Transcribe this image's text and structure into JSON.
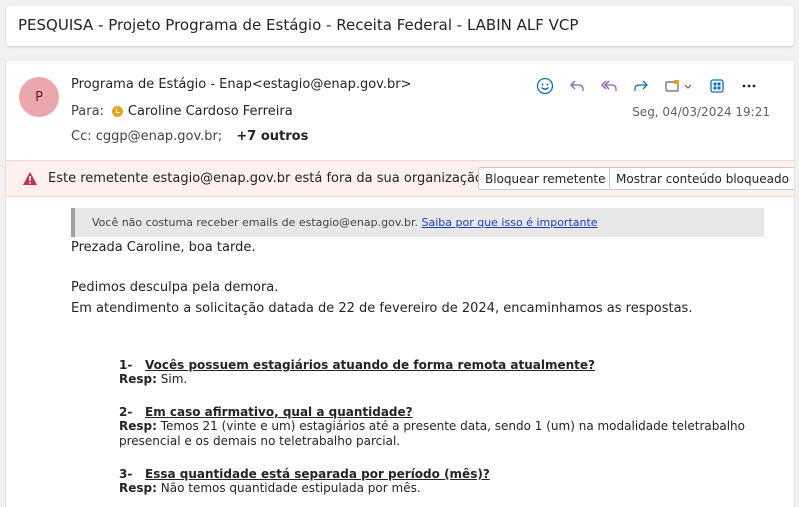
{
  "subject": "PESQUISA - Projeto Programa de Estágio - Receita Federal - LABIN ALF VCP",
  "sender": {
    "avatar_letter": "P",
    "display": "Programa de Estágio - Enap<estagio@enap.gov.br>"
  },
  "to": {
    "label": "Para:",
    "name": "Caroline Cardoso Ferreira"
  },
  "cc": {
    "label": "Cc:",
    "address": "cggp@enap.gov.br;",
    "others": "+7 outros"
  },
  "date": "Seg, 04/03/2024 19:21",
  "toolbar_icons": [
    "smiley-icon",
    "reply-icon",
    "reply-all-icon",
    "forward-icon",
    "apps-icon",
    "more-icon"
  ],
  "warning": {
    "text": "Este remetente estagio@enap.gov.br está fora da sua organização.",
    "block_button": "Bloquear remetente",
    "show_button": "Mostrar conteúdo bloqueado"
  },
  "notice": {
    "text": "Você não costuma receber emails de estagio@enap.gov.br.",
    "link": "Saiba por que isso é importante"
  },
  "body": {
    "greeting": "Prezada Caroline, boa tarde.",
    "line1": "Pedimos desculpa pela demora.",
    "line2": "Em atendimento a solicitação datada de 22 de fevereiro de 2024, encaminhamos as respostas."
  },
  "questions": [
    {
      "number": "1-",
      "question": "Vocês possuem estagiários atuando de forma remota atualmente?",
      "resp_label": "Resp:",
      "answer": "Sim."
    },
    {
      "number": "2-",
      "question": "Em caso afirmativo, qual a quantidade?",
      "resp_label": "Resp:",
      "answer_line1": "Temos 21 (vinte e um) estagiários até a presente data, sendo 1 (um) na modalidade teletrabalho",
      "answer_line2": "presencial e os demais no teletrabalho parcial."
    },
    {
      "number": "3-",
      "question": "Essa quantidade está separada por período (mês)?",
      "resp_label": "Resp:",
      "answer": "Não temos quantidade estipulada por mês."
    }
  ],
  "colors": {
    "avatar_bg": "#eaa8ac",
    "accent_blue": "#0f6cbd",
    "reply_purple": "#8a5fb5",
    "warning_red": "#c4314b",
    "presence_orange": "#e8a317"
  }
}
